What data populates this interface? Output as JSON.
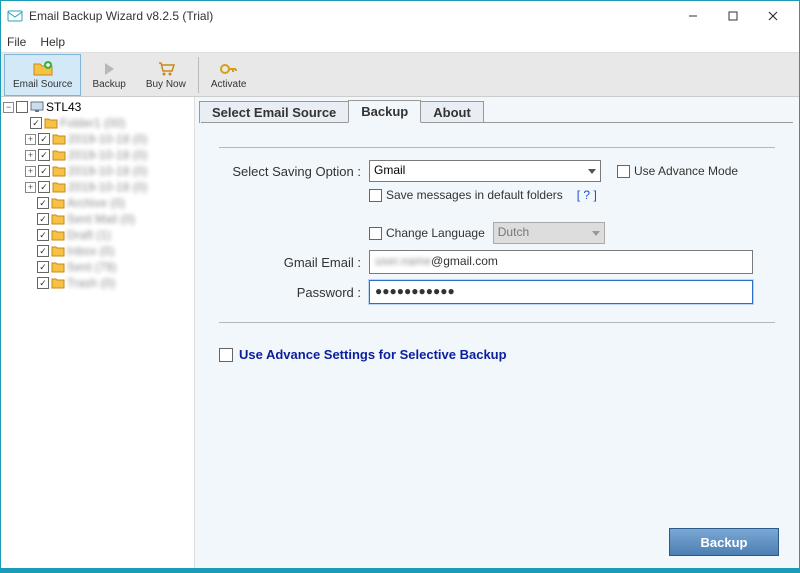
{
  "window": {
    "title": "Email Backup Wizard v8.2.5 (Trial)"
  },
  "menubar": {
    "file": "File",
    "help": "Help"
  },
  "toolbar": {
    "email_source": "Email Source",
    "backup": "Backup",
    "buy_now": "Buy Now",
    "activate": "Activate"
  },
  "tree": {
    "root": "STL43",
    "items": [
      {
        "label": "Folder1 (00)"
      },
      {
        "label": "2019-10-18 (0)"
      },
      {
        "label": "2019-10-18 (0)"
      },
      {
        "label": "2019-10-18 (0)"
      },
      {
        "label": "2019-10-18 (0)"
      },
      {
        "label": "Archive (0)"
      },
      {
        "label": "Sent Mail (0)"
      },
      {
        "label": "Draft (1)"
      },
      {
        "label": "Inbox (0)"
      },
      {
        "label": "Sent (79)"
      },
      {
        "label": "Trash (0)"
      }
    ]
  },
  "tabs": {
    "select_source": "Select Email Source",
    "backup": "Backup",
    "about": "About"
  },
  "form": {
    "saving_option_label": "Select Saving Option :",
    "saving_option_value": "Gmail",
    "use_advance_mode": "Use Advance Mode",
    "save_default": "Save messages in default folders",
    "help": "[ ? ]",
    "change_language": "Change Language",
    "language_value": "Dutch",
    "gmail_email_label": "Gmail Email :",
    "gmail_email_blurred": "user.name",
    "gmail_email_domain": "@gmail.com",
    "password_label": "Password :",
    "password_value": "●●●●●●●●●●●",
    "advance_settings": "Use Advance Settings for Selective Backup",
    "backup_button": "Backup"
  }
}
